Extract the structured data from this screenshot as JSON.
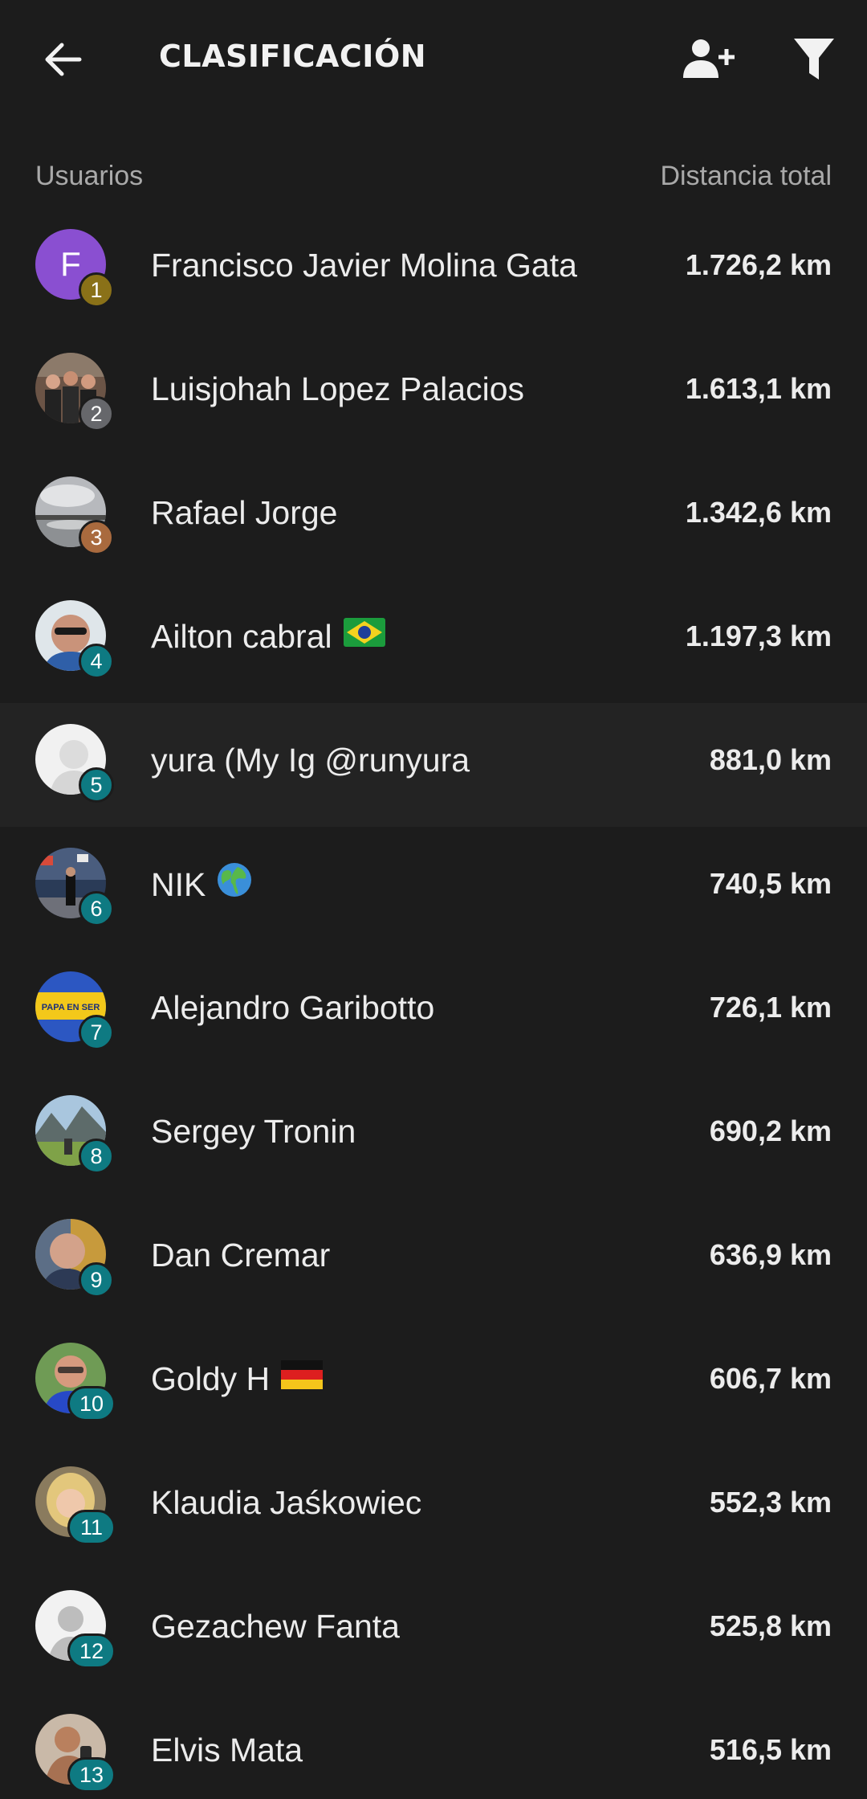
{
  "header": {
    "title": "CLASIFICACIÓN",
    "back_icon": "arrow-left-icon",
    "add_friend_icon": "person-add-icon",
    "filter_icon": "funnel-filter-icon"
  },
  "columns": {
    "users_label": "Usuarios",
    "distance_label": "Distancia total"
  },
  "colors": {
    "background": "#1c1c1c",
    "gold_badge": "#8a7118",
    "silver_badge": "#66676b",
    "bronze_badge": "#a96a3e",
    "rank_badge": "#0e7a82",
    "avatar_initial_bg": "#8a4fd1"
  },
  "rows": [
    {
      "rank": "1",
      "name": "Francisco Javier Molina Gata",
      "distance": "1.726,2 km",
      "avatar_initial": "F"
    },
    {
      "rank": "2",
      "name": "Luisjohah Lopez Palacios",
      "distance": "1.613,1 km"
    },
    {
      "rank": "3",
      "name": "Rafael Jorge",
      "distance": "1.342,6 km"
    },
    {
      "rank": "4",
      "name": "Ailton cabral",
      "distance": "1.197,3 km",
      "flag": "brazil-flag-icon"
    },
    {
      "rank": "5",
      "name": "yura (My Ig @runyura",
      "distance": "881,0 km"
    },
    {
      "rank": "6",
      "name": "NIK",
      "distance": "740,5 km",
      "flag": "globe-icon"
    },
    {
      "rank": "7",
      "name": "Alejandro Garibotto",
      "distance": "726,1 km",
      "avatar_text": "PAPA EN SER"
    },
    {
      "rank": "8",
      "name": "Sergey Tronin",
      "distance": "690,2 km"
    },
    {
      "rank": "9",
      "name": "Dan Cremar",
      "distance": "636,9 km"
    },
    {
      "rank": "10",
      "name": "Goldy H",
      "distance": "606,7 km",
      "flag": "germany-flag-icon"
    },
    {
      "rank": "11",
      "name": "Klaudia Jaśkowiec",
      "distance": "552,3 km"
    },
    {
      "rank": "12",
      "name": "Gezachew Fanta",
      "distance": "525,8 km"
    },
    {
      "rank": "13",
      "name": "Elvis Mata",
      "distance": "516,5 km"
    }
  ]
}
